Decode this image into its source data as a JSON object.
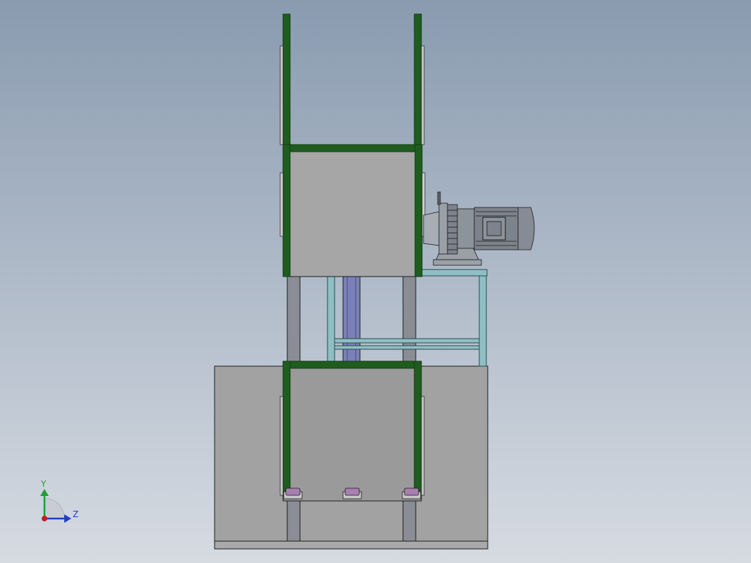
{
  "viewport": {
    "background_top": "#8a9bb0",
    "background_bottom": "#d6dbe2"
  },
  "colors": {
    "frame_green": "#1f5c1f",
    "frame_green_dark": "#123d12",
    "panel_gray": "#a4a4a4",
    "panel_gray_dark": "#9a9a9a",
    "column_gray": "#8a8d96",
    "shaft_blue": "#7b80b8",
    "support_teal": "#8fbfc4",
    "motor_gray": "#7d838c",
    "roller_purple": "#a87fb0",
    "outline": "#1a1a1a"
  },
  "triad": {
    "x_label": "Z",
    "y_label": "Y",
    "x_color": "#1f3fbf",
    "y_color": "#1f9f2f",
    "origin_color": "#c02020",
    "icon": "coordinate-triad-icon"
  }
}
